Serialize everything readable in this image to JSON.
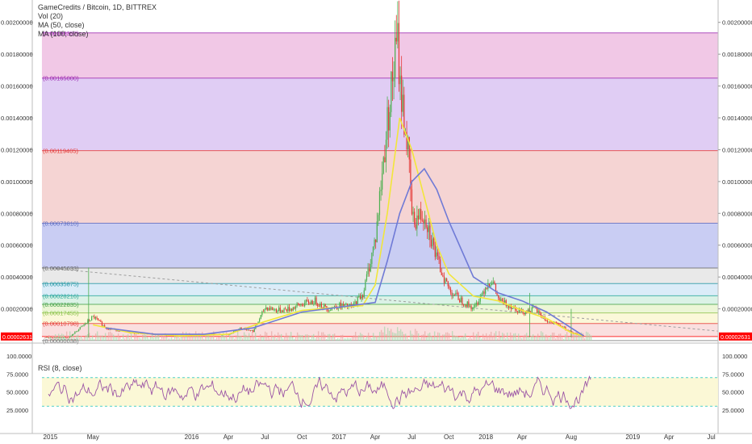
{
  "header": {
    "title": "GameCredits / Bitcoin, 1D, BITTREX",
    "indicators": [
      "Vol (20)",
      "MA (50, close)",
      "MA (100, close)"
    ]
  },
  "rsi_panel": {
    "title": "RSI (8, close)",
    "ticks": [
      "100.0000",
      "75.0000",
      "50.0000",
      "25.0000"
    ]
  },
  "price_axis": {
    "ticks": [
      "0.00200000",
      "0.00180000",
      "0.00160000",
      "0.00140000",
      "0.00120000",
      "0.00100000",
      "0.00080000",
      "0.00060000",
      "0.00040000",
      "0.00020000"
    ],
    "last_price_label": "0.00002631"
  },
  "time_axis": {
    "labels": [
      "2015",
      "May",
      "2016",
      "Apr",
      "Jul",
      "Oct",
      "2017",
      "Apr",
      "Jul",
      "Oct",
      "2018",
      "Apr",
      "Aug",
      "2019",
      "Apr",
      "Jul"
    ]
  },
  "colors": {
    "candle_up": "#4caf50",
    "candle_down": "#e53935",
    "ma50": "#f2e63a",
    "ma100": "#6f7ad6",
    "rsi_line": "#9c56a6",
    "last_price_bg": "#ff0000"
  },
  "chart_data": [
    {
      "type": "line",
      "title": "GameCredits / Bitcoin, 1D, BITTREX",
      "ylim": [
        0,
        0.0021
      ],
      "x_range": [
        "2014-12",
        "2019-08"
      ],
      "series": [
        {
          "name": "GameCredits / Bitcoin",
          "x": [
            "2015-01",
            "2015-03",
            "2015-05",
            "2015-06",
            "2015-08",
            "2015-10",
            "2015-12",
            "2016-02",
            "2016-04",
            "2016-05",
            "2016-06",
            "2016-07",
            "2016-08",
            "2016-09",
            "2016-10",
            "2016-11",
            "2016-12",
            "2017-01",
            "2017-02",
            "2017-03",
            "2017-04",
            "2017-05",
            "2017-05-25",
            "2017-06",
            "2017-06-20",
            "2017-07",
            "2017-08",
            "2017-09",
            "2017-10",
            "2017-11",
            "2017-12",
            "2018-01",
            "2018-01-15",
            "2018-02",
            "2018-03",
            "2018-04",
            "2018-05",
            "2018-06",
            "2018-07",
            "2018-08",
            "2018-09"
          ],
          "values": [
            2e-05,
            2e-05,
            0.00015,
            8e-05,
            5e-05,
            4e-05,
            3e-05,
            4e-05,
            4e-05,
            8e-05,
            6e-05,
            0.00021,
            0.00019,
            0.0002,
            0.00023,
            0.00025,
            0.0002,
            0.00022,
            0.00021,
            0.0003,
            0.00065,
            0.0014,
            0.0019,
            0.0016,
            0.0012,
            0.00075,
            0.0008,
            0.0005,
            0.00032,
            0.00025,
            0.0002,
            0.00035,
            0.00038,
            0.00025,
            0.00022,
            0.00018,
            0.0002,
            0.00012,
            0.0001,
            5e-05,
            3e-05
          ]
        },
        {
          "name": "MA (50, close)",
          "x": [
            "2015-05",
            "2015-08",
            "2015-12",
            "2016-04",
            "2016-07",
            "2016-10",
            "2017-01",
            "2017-03",
            "2017-04",
            "2017-05",
            "2017-06",
            "2017-07",
            "2017-08",
            "2017-09",
            "2017-10",
            "2017-12",
            "2018-02",
            "2018-04",
            "2018-06",
            "2018-08",
            "2018-09"
          ],
          "values": [
            0.0001,
            5e-05,
            3e-05,
            4e-05,
            0.00012,
            0.00019,
            0.00021,
            0.00022,
            0.00035,
            0.0008,
            0.0014,
            0.0012,
            0.0009,
            0.0006,
            0.00042,
            0.00028,
            0.00025,
            0.00019,
            0.00014,
            5e-05,
            3e-05
          ]
        },
        {
          "name": "MA (100, close)",
          "x": [
            "2015-06",
            "2015-10",
            "2016-02",
            "2016-06",
            "2016-10",
            "2017-01",
            "2017-04",
            "2017-05",
            "2017-06",
            "2017-07",
            "2017-08",
            "2017-09",
            "2017-10",
            "2017-12",
            "2018-02",
            "2018-04",
            "2018-06",
            "2018-08",
            "2018-09"
          ],
          "values": [
            8e-05,
            4e-05,
            4e-05,
            8e-05,
            0.00018,
            0.00021,
            0.00024,
            0.0005,
            0.0008,
            0.001,
            0.00108,
            0.00095,
            0.00075,
            0.0004,
            0.0003,
            0.00025,
            0.00018,
            8e-05,
            3e-05
          ]
        }
      ],
      "fibonacci_levels": [
        "0.00193357",
        "0.00165000",
        "0.00119405",
        "0.00073810",
        "0.00045633",
        "0.00035875",
        "0.00028216",
        "0.00022835",
        "0.00017455",
        "0.00010798",
        "0.00002631",
        "0.00000038"
      ],
      "fibonacci_values": [
        0.00193357,
        0.00165,
        0.00119405,
        0.0007381,
        0.00045633,
        0.00035875,
        0.00028216,
        0.00022835,
        0.00017455,
        0.00010798,
        2.631e-05,
        3.8e-07
      ],
      "fibonacci_colors": [
        "#ecb6dd",
        "#d6bcf0",
        "#f2c6c4",
        "#b7bcef",
        "#e2e2e2",
        "#cfe6f5",
        "#cfeedd",
        "#e6f3c8",
        "#f9f6cc",
        "#f8d4d4",
        "#ffffff"
      ],
      "fibonacci_label_colors": [
        "#9c27b0",
        "#9c27b0",
        "#e53935",
        "#5c6bc0",
        "#666666",
        "#2196a3",
        "#26a69a",
        "#43a047",
        "#8bc34a",
        "#e53935",
        "#ff0000",
        "#777777"
      ]
    },
    {
      "type": "line",
      "title": "RSI (8, close)",
      "ylim": [
        0,
        100
      ],
      "bands": [
        30,
        70
      ],
      "series": [
        {
          "name": "RSI (8, close)"
        }
      ]
    }
  ]
}
